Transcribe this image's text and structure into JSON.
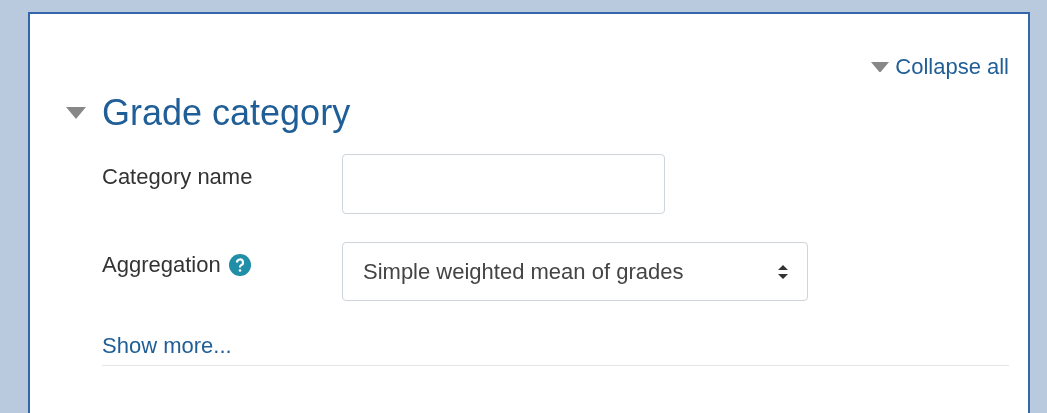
{
  "collapse_all": {
    "label": "Collapse all"
  },
  "section": {
    "title": "Grade category",
    "expanded": true,
    "fields": [
      {
        "kind": "text",
        "label": "Category name",
        "help": false
      },
      {
        "kind": "select",
        "label": "Aggregation",
        "help": true,
        "value": "Simple weighted mean of grades"
      }
    ],
    "show_more": "Show more..."
  }
}
